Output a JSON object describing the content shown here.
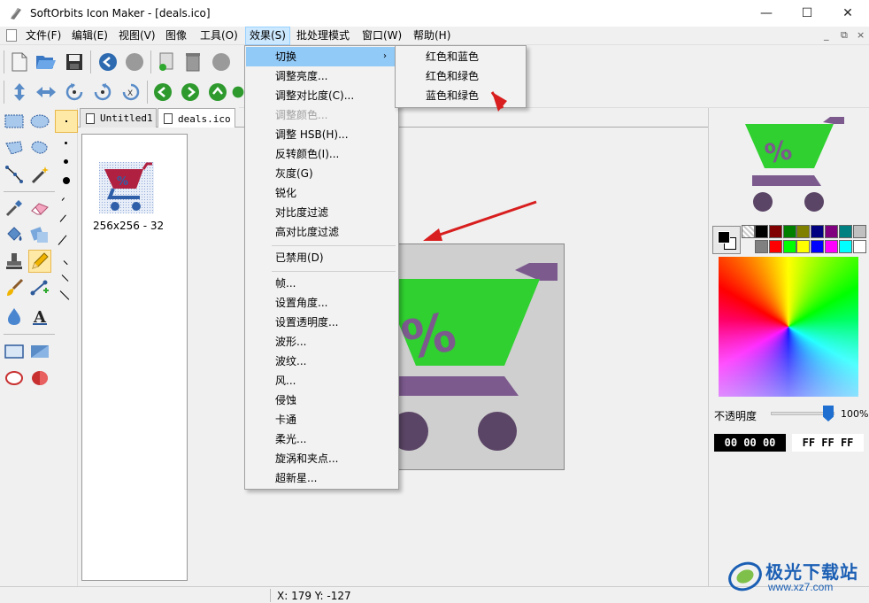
{
  "window": {
    "title": "SoftOrbits Icon Maker - [deals.ico]",
    "minimize_glyph": "—",
    "maximize_glyph": "☐",
    "close_glyph": "✕"
  },
  "menubar": {
    "items": [
      "文件(F)",
      "编辑(E)",
      "视图(V)",
      "图像",
      "工具(O)",
      "效果(S)",
      "批处理模式",
      "窗口(W)",
      "帮助(H)"
    ],
    "active_index": 5,
    "mdi_minimize": "_",
    "mdi_restore": "⧉",
    "mdi_close": "×"
  },
  "tabs": [
    "Untitled1",
    "deals.ico"
  ],
  "active_tab": 1,
  "thumbnails": [
    {
      "label": "256x256 - 32"
    }
  ],
  "effects_menu": {
    "items": [
      {
        "label": "切换",
        "has_submenu": true,
        "highlighted": true
      },
      {
        "label": "调整亮度..."
      },
      {
        "label": "调整对比度(C)..."
      },
      {
        "label": "调整颜色...",
        "disabled": true
      },
      {
        "label": "调整 HSB(H)..."
      },
      {
        "label": "反转颜色(I)..."
      },
      {
        "label": "灰度(G)"
      },
      {
        "label": "锐化"
      },
      {
        "label": "对比度过滤"
      },
      {
        "label": "高对比度过滤"
      },
      {
        "label": "已禁用(D)"
      },
      {
        "label": "帧..."
      },
      {
        "label": "设置角度..."
      },
      {
        "label": "设置透明度..."
      },
      {
        "label": "波形..."
      },
      {
        "label": "波纹..."
      },
      {
        "label": "风..."
      },
      {
        "label": "侵蚀"
      },
      {
        "label": "卡通"
      },
      {
        "label": "柔光..."
      },
      {
        "label": "旋涡和夹点..."
      },
      {
        "label": "超新星..."
      }
    ],
    "submenu_arrow": "›"
  },
  "switch_submenu": {
    "items": [
      "红色和蓝色",
      "红色和绿色",
      "蓝色和绿色"
    ]
  },
  "color_panel": {
    "palette_top": [
      "#000000",
      "#800000",
      "#008000",
      "#808000",
      "#000080",
      "#800080",
      "#008080",
      "#c0c0c0"
    ],
    "palette_bottom": [
      "#808080",
      "#ff0000",
      "#00ff00",
      "#ffff00",
      "#0000ff",
      "#ff00ff",
      "#00ffff",
      "#ffffff"
    ],
    "opacity_label": "不透明度",
    "opacity_value": "100%",
    "opacity_fraction": 1.0,
    "primary_hex": "00 00 00",
    "secondary_hex": "FF FF FF"
  },
  "icon_colors": {
    "cart_green": "#2fd02f",
    "cart_purple": "#7c5a8e",
    "wheel_dark": "#5b4566",
    "thumb_red": "#b02040",
    "thumb_blue": "#2f5fa8"
  },
  "status": {
    "coords": "X: 179 Y: -127"
  },
  "watermark": {
    "title": "极光下载站",
    "url": "www.xz7.com"
  }
}
